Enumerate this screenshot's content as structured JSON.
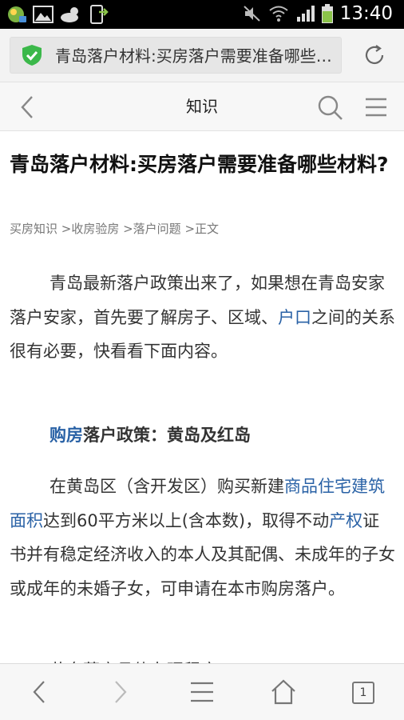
{
  "status_bar": {
    "time": "13:40",
    "left_icons": [
      "weather-app-icon",
      "mail-notification-icon",
      "gallery-icon",
      "weather-cloud-icon",
      "phone-update-icon"
    ],
    "right_icons": [
      "mute-icon",
      "wifi-icon",
      "signal-icon",
      "battery-icon"
    ]
  },
  "url_bar": {
    "text": "青岛落户材料:买房落户需要准备哪些材料?",
    "secure_icon": "shield-check-icon",
    "accent": "#3bb84a"
  },
  "header": {
    "title": "知识"
  },
  "article": {
    "title": "青岛落户材料:买房落户需要准备哪些材料?",
    "breadcrumb": "买房知识 >收房验房 >落户问题 >正文",
    "p1": {
      "text_a": "青岛最新落户政策出来了，如果想在青岛安家落户安家，首先要了解房子、区域、",
      "link": "户口",
      "text_b": "之间的关系很有必要，快看看下面内容。"
    },
    "subhead": {
      "link": "购房",
      "text": "落户政策：黄岛及红岛"
    },
    "p2": {
      "text_a": "在黄岛区（含开发区）购买新建",
      "link_a": "商品住宅建筑面积",
      "text_b": "达到60平方米以上(含本数)，取得不动",
      "link_b": "产权",
      "text_c": "证书并有稳定经济收入的本人及其配偶、未成年的子女或成年的未婚子女，可申请在本市购房落户。"
    },
    "p3": {
      "text": "黄岛落户具体办理程序："
    },
    "link_color": "#2a62a6"
  },
  "toolbar": {
    "tabs_count": "1"
  }
}
